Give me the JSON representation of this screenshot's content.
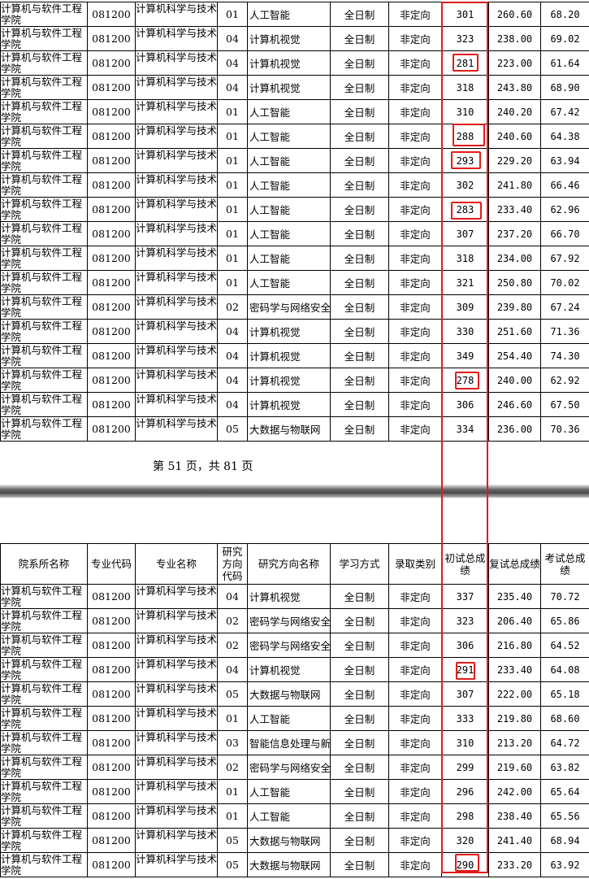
{
  "page1": {
    "rows": [
      [
        "计算机与软件工程学院",
        "081200",
        "计算机科学与技术",
        "01",
        "人工智能",
        "全日制",
        "非定向",
        "301",
        "260.60",
        "68.20"
      ],
      [
        "计算机与软件工程学院",
        "081200",
        "计算机科学与技术",
        "04",
        "计算机视觉",
        "全日制",
        "非定向",
        "323",
        "238.00",
        "69.02"
      ],
      [
        "计算机与软件工程学院",
        "081200",
        "计算机科学与技术",
        "04",
        "计算机视觉",
        "全日制",
        "非定向",
        "281",
        "223.00",
        "61.64"
      ],
      [
        "计算机与软件工程学院",
        "081200",
        "计算机科学与技术",
        "04",
        "计算机视觉",
        "全日制",
        "非定向",
        "318",
        "243.80",
        "68.90"
      ],
      [
        "计算机与软件工程学院",
        "081200",
        "计算机科学与技术",
        "01",
        "人工智能",
        "全日制",
        "非定向",
        "310",
        "240.20",
        "67.42"
      ],
      [
        "计算机与软件工程学院",
        "081200",
        "计算机科学与技术",
        "01",
        "人工智能",
        "全日制",
        "非定向",
        "288",
        "240.60",
        "64.38"
      ],
      [
        "计算机与软件工程学院",
        "081200",
        "计算机科学与技术",
        "01",
        "人工智能",
        "全日制",
        "非定向",
        "293",
        "229.20",
        "63.94"
      ],
      [
        "计算机与软件工程学院",
        "081200",
        "计算机科学与技术",
        "01",
        "人工智能",
        "全日制",
        "非定向",
        "302",
        "241.80",
        "66.46"
      ],
      [
        "计算机与软件工程学院",
        "081200",
        "计算机科学与技术",
        "01",
        "人工智能",
        "全日制",
        "非定向",
        "283",
        "233.40",
        "62.96"
      ],
      [
        "计算机与软件工程学院",
        "081200",
        "计算机科学与技术",
        "01",
        "人工智能",
        "全日制",
        "非定向",
        "307",
        "237.20",
        "66.70"
      ],
      [
        "计算机与软件工程学院",
        "081200",
        "计算机科学与技术",
        "01",
        "人工智能",
        "全日制",
        "非定向",
        "318",
        "234.00",
        "67.92"
      ],
      [
        "计算机与软件工程学院",
        "081200",
        "计算机科学与技术",
        "01",
        "人工智能",
        "全日制",
        "非定向",
        "321",
        "250.80",
        "70.02"
      ],
      [
        "计算机与软件工程学院",
        "081200",
        "计算机科学与技术",
        "02",
        "密码学与网络安全",
        "全日制",
        "非定向",
        "309",
        "239.80",
        "67.24"
      ],
      [
        "计算机与软件工程学院",
        "081200",
        "计算机科学与技术",
        "04",
        "计算机视觉",
        "全日制",
        "非定向",
        "330",
        "251.60",
        "71.36"
      ],
      [
        "计算机与软件工程学院",
        "081200",
        "计算机科学与技术",
        "04",
        "计算机视觉",
        "全日制",
        "非定向",
        "349",
        "254.40",
        "74.30"
      ],
      [
        "计算机与软件工程学院",
        "081200",
        "计算机科学与技术",
        "04",
        "计算机视觉",
        "全日制",
        "非定向",
        "278",
        "240.00",
        "62.92"
      ],
      [
        "计算机与软件工程学院",
        "081200",
        "计算机科学与技术",
        "04",
        "计算机视觉",
        "全日制",
        "非定向",
        "306",
        "246.60",
        "67.50"
      ],
      [
        "计算机与软件工程学院",
        "081200",
        "计算机科学与技术",
        "05",
        "大数据与物联网",
        "全日制",
        "非定向",
        "334",
        "236.00",
        "70.36"
      ]
    ],
    "footer": "第 51 页，共 81 页"
  },
  "page2": {
    "headers": [
      "院系所名称",
      "专业代码",
      "专业名称",
      "研究方向代码",
      "研究方向名称",
      "学习方式",
      "录取类别",
      "初试总成绩",
      "复试总成绩",
      "考试总成绩"
    ],
    "rows": [
      [
        "计算机与软件工程学院",
        "081200",
        "计算机科学与技术",
        "04",
        "计算机视觉",
        "全日制",
        "非定向",
        "337",
        "235.40",
        "70.72"
      ],
      [
        "计算机与软件工程学院",
        "081200",
        "计算机科学与技术",
        "02",
        "密码学与网络安全",
        "全日制",
        "非定向",
        "323",
        "206.40",
        "65.86"
      ],
      [
        "计算机与软件工程学院",
        "081200",
        "计算机科学与技术",
        "02",
        "密码学与网络安全",
        "全日制",
        "非定向",
        "306",
        "216.80",
        "64.52"
      ],
      [
        "计算机与软件工程学院",
        "081200",
        "计算机科学与技术",
        "04",
        "计算机视觉",
        "全日制",
        "非定向",
        "291",
        "233.40",
        "64.08"
      ],
      [
        "计算机与软件工程学院",
        "081200",
        "计算机科学与技术",
        "05",
        "大数据与物联网",
        "全日制",
        "非定向",
        "307",
        "222.00",
        "65.18"
      ],
      [
        "计算机与软件工程学院",
        "081200",
        "计算机科学与技术",
        "01",
        "人工智能",
        "全日制",
        "非定向",
        "333",
        "219.80",
        "68.60"
      ],
      [
        "计算机与软件工程学院",
        "081200",
        "计算机科学与技术",
        "03",
        "智能信息处理与新型计算模型",
        "全日制",
        "非定向",
        "310",
        "213.20",
        "64.72"
      ],
      [
        "计算机与软件工程学院",
        "081200",
        "计算机科学与技术",
        "02",
        "密码学与网络安全",
        "全日制",
        "非定向",
        "299",
        "219.60",
        "63.82"
      ],
      [
        "计算机与软件工程学院",
        "081200",
        "计算机科学与技术",
        "01",
        "人工智能",
        "全日制",
        "非定向",
        "296",
        "242.00",
        "65.64"
      ],
      [
        "计算机与软件工程学院",
        "081200",
        "计算机科学与技术",
        "01",
        "人工智能",
        "全日制",
        "非定向",
        "298",
        "238.40",
        "65.56"
      ],
      [
        "计算机与软件工程学院",
        "081200",
        "计算机科学与技术",
        "05",
        "大数据与物联网",
        "全日制",
        "非定向",
        "320",
        "241.40",
        "68.94"
      ],
      [
        "计算机与软件工程学院",
        "081200",
        "计算机科学与技术",
        "05",
        "大数据与物联网",
        "全日制",
        "非定向",
        "290",
        "233.20",
        "63.92"
      ]
    ]
  },
  "highlight_color": "#e31b1b",
  "highlighted_scores": [
    "281",
    "288",
    "293",
    "283",
    "278",
    "291",
    "290"
  ]
}
